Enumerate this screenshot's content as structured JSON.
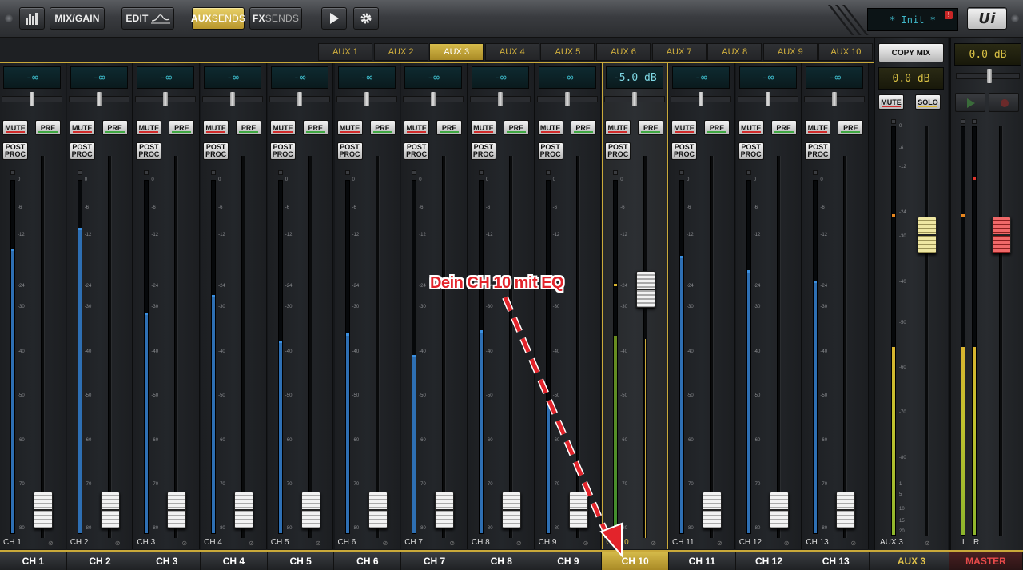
{
  "toolbar": {
    "meters_icon": "meters-icon",
    "mix_gain_label": "MIX/GAIN",
    "edit_label": "EDIT",
    "aux_label_a": "AUX",
    "aux_label_b": "SENDS",
    "fx_label_a": "FX",
    "fx_label_b": "SENDS",
    "play_icon": "play-icon",
    "settings_icon": "gear-icon",
    "init_text": "* Init *",
    "init_badge": "!",
    "logo": "Ui"
  },
  "aux_tabs": [
    "AUX 1",
    "AUX 2",
    "AUX 3",
    "AUX 4",
    "AUX 5",
    "AUX 6",
    "AUX 7",
    "AUX 8",
    "AUX 9",
    "AUX 10"
  ],
  "active_aux_tab": 2,
  "scale_labels": [
    "0",
    "-6",
    "-12",
    "-24",
    "-30",
    "-40",
    "-50",
    "-60",
    "-70",
    "-80"
  ],
  "channels": [
    {
      "name": "CH 1",
      "level": "-∞",
      "meter": 0.8,
      "fader": 0.0
    },
    {
      "name": "CH 2",
      "level": "-∞",
      "meter": 0.86,
      "fader": 0.0
    },
    {
      "name": "CH 3",
      "level": "-∞",
      "meter": 0.62,
      "fader": 0.0
    },
    {
      "name": "CH 4",
      "level": "-∞",
      "meter": 0.67,
      "fader": 0.0
    },
    {
      "name": "CH 5",
      "level": "-∞",
      "meter": 0.54,
      "fader": 0.0
    },
    {
      "name": "CH 6",
      "level": "-∞",
      "meter": 0.56,
      "fader": 0.0
    },
    {
      "name": "CH 7",
      "level": "-∞",
      "meter": 0.5,
      "fader": 0.0
    },
    {
      "name": "CH 8",
      "level": "-∞",
      "meter": 0.57,
      "fader": 0.0
    },
    {
      "name": "CH 9",
      "level": "-∞",
      "meter": 0.36,
      "fader": 0.0
    },
    {
      "name": "CH 10",
      "level": "-5.0 dB",
      "meter": 0.56,
      "fader": 0.64
    },
    {
      "name": "CH 11",
      "level": "-∞",
      "meter": 0.78,
      "fader": 0.0
    },
    {
      "name": "CH 12",
      "level": "-∞",
      "meter": 0.74,
      "fader": 0.0
    },
    {
      "name": "CH 13",
      "level": "-∞",
      "meter": 0.71,
      "fader": 0.0
    }
  ],
  "selected_channel": 9,
  "buttons": {
    "mute": "MUTE",
    "pre": "PRE",
    "post_a": "POST",
    "post_b": "PROC",
    "solo": "SOLO"
  },
  "aux_master": {
    "copy_mix": "COPY MIX",
    "level": "0.0 dB",
    "name": "AUX 3",
    "fader": 0.78
  },
  "master": {
    "level": "0.0 dB",
    "name": "MASTER",
    "l": "L",
    "r": "R",
    "fader": 0.78
  },
  "aux_scale": [
    "0",
    "-6",
    "-12",
    "-24",
    "-30",
    "-40",
    "-50",
    "-60",
    "-70",
    "-80",
    "1",
    "5",
    "10",
    "15",
    "20"
  ],
  "annotation": "Dein CH 10 mit EQ",
  "colors": {
    "accent": "#c9a93a",
    "meter_blue": "#2e6fb3",
    "lcd_cyan": "#3fc0d0",
    "annotation_red": "#e3242b"
  }
}
